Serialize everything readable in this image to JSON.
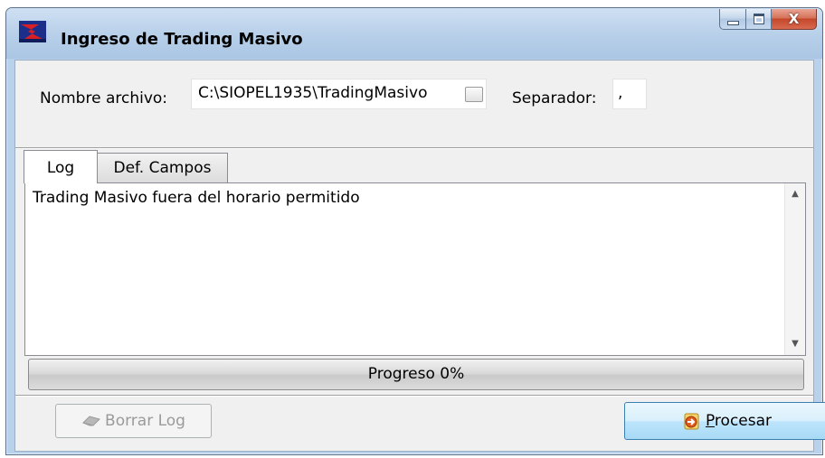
{
  "window": {
    "title": "Ingreso de Trading Masivo",
    "close_glyph": "X"
  },
  "form": {
    "file_label": "Nombre archivo:",
    "file_value": "C:\\SIOPEL1935\\TradingMasivo",
    "separator_label": "Separador:",
    "separator_value": ","
  },
  "tabs": [
    {
      "label": "Log",
      "active": true
    },
    {
      "label": "Def. Campos",
      "active": false
    }
  ],
  "log": {
    "lines": [
      "Trading Masivo fuera del horario permitido"
    ]
  },
  "progress": {
    "label": "Progreso 0%",
    "value": 0
  },
  "buttons": {
    "clear_log": "Borrar Log",
    "process_mnemonic": "P",
    "process_rest": "rocesar"
  },
  "icons": {
    "app": "siopel-app-icon",
    "clear": "eraser-icon",
    "process": "process-icon",
    "browse": "browse-icon"
  },
  "colors": {
    "titlebar": "#b9d1ea",
    "client": "#f0f0f0",
    "close_button": "#c4472b",
    "process_button": "#bee6fd",
    "progress_fill": "#3fc14a"
  }
}
